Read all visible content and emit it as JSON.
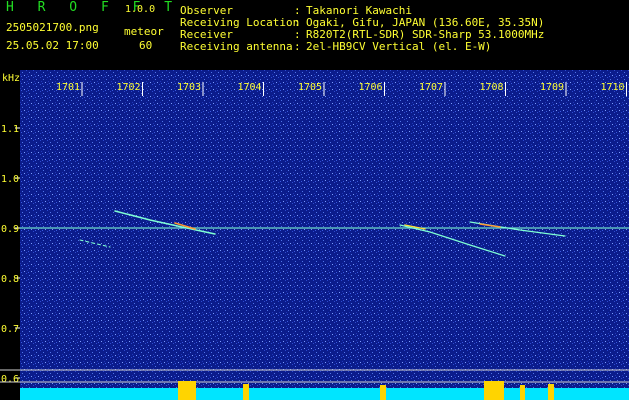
{
  "header": {
    "brand": "H R O F F T",
    "version": "1.0.0",
    "filename": "2505021700.png",
    "datetime": "25.05.02 17:00",
    "mode": "meteor",
    "count": "60",
    "rows": [
      {
        "label": "Observer",
        "sep": ":",
        "value": "Takanori Kawachi"
      },
      {
        "label": "Receiving Location",
        "sep": ":",
        "value": "Ogaki, Gifu, JAPAN (136.60E, 35.35N)"
      },
      {
        "label": "Receiver",
        "sep": ":",
        "value": "R820T2(RTL-SDR) SDR-Sharp 53.1000MHz"
      },
      {
        "label": "Receiving antenna",
        "sep": ":",
        "value": "2el-HB9CV Vertical (el. E-W)"
      }
    ]
  },
  "axis": {
    "unit": "kHz",
    "time_ticks": [
      "1701",
      "1702",
      "1703",
      "1704",
      "1705",
      "1706",
      "1707",
      "1708",
      "1709",
      "1710"
    ],
    "freq_ticks": [
      {
        "label": "1.1",
        "value": 1.1
      },
      {
        "label": "1.0",
        "value": 1.0
      },
      {
        "label": "0.9",
        "value": 0.9
      },
      {
        "label": "0.8",
        "value": 0.8
      },
      {
        "label": "0.7",
        "value": 0.7
      },
      {
        "label": "0.6",
        "value": 0.6
      }
    ]
  },
  "colors": {
    "background": "#0a1a8a",
    "carrier": "#7fffd4",
    "header_green": "#22dd22",
    "header_yellow": "#ffff33",
    "bottom_bar": "#00e5ff",
    "bottom_peaks": "#ffd400"
  }
}
